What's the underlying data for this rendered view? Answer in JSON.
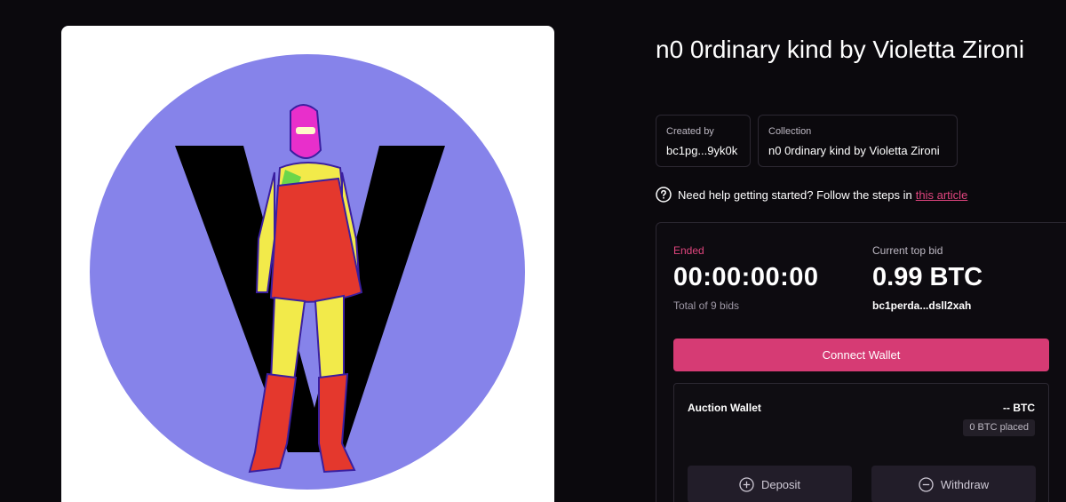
{
  "artwork": {
    "alt": "Artwork"
  },
  "title": "n0 0rdinary kind by Violetta Zironi",
  "created_by": {
    "label": "Created by",
    "value": "bc1pg...9yk0k"
  },
  "collection": {
    "label": "Collection",
    "value": "n0 0rdinary kind by Violetta Zironi"
  },
  "help": {
    "text": "Need help getting started? Follow the steps in",
    "link_text": "this article",
    "icon": "question-circle-icon"
  },
  "auction": {
    "status": "Ended",
    "timer": "00:00:00:00",
    "bids_total": "Total of 9 bids",
    "top_bid_label": "Current top bid",
    "top_bid_value": "0.99 BTC",
    "top_bidder": "bc1perda...dsll2xah"
  },
  "connect_wallet_label": "Connect Wallet",
  "wallet": {
    "title": "Auction Wallet",
    "balance": "-- BTC",
    "placed": "0 BTC placed",
    "deposit_label": "Deposit",
    "withdraw_label": "Withdraw",
    "deposit_icon": "plus-circle-icon",
    "withdraw_icon": "minus-circle-icon"
  },
  "colors": {
    "background": "#0b090d",
    "accent": "#d63b74",
    "ended": "#e0457e",
    "art_circle": "#8683ea"
  }
}
